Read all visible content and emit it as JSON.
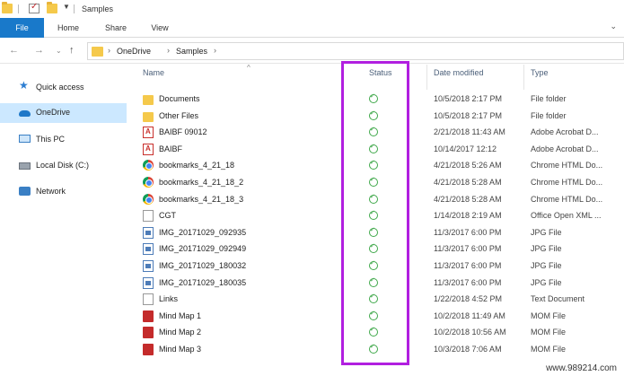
{
  "window": {
    "title": "Samples"
  },
  "ribbon": {
    "tabs": [
      "File",
      "Home",
      "Share",
      "View"
    ],
    "help_icon": "chevron-down-icon"
  },
  "address": {
    "crumbs": [
      "OneDrive",
      "Samples"
    ]
  },
  "sidebar": {
    "items": [
      {
        "label": "Quick access",
        "icon": "star-icon",
        "selected": false
      },
      {
        "label": "OneDrive",
        "icon": "cloud-icon",
        "selected": true
      },
      {
        "label": "This PC",
        "icon": "computer-icon",
        "selected": false
      },
      {
        "label": "Local Disk (C:)",
        "icon": "disk-icon",
        "selected": false
      },
      {
        "label": "Network",
        "icon": "network-icon",
        "selected": false
      }
    ]
  },
  "columns": {
    "name": "Name",
    "status": "Status",
    "date": "Date modified",
    "type": "Type"
  },
  "files": [
    {
      "name": "Documents",
      "date": "10/5/2018 2:17 PM",
      "type": "File folder",
      "icon": "folder"
    },
    {
      "name": "Other Files",
      "date": "10/5/2018 2:17 PM",
      "type": "File folder",
      "icon": "folder"
    },
    {
      "name": "BAIBF 09012",
      "date": "2/21/2018 11:43 AM",
      "type": "Adobe Acrobat D...",
      "icon": "pdf"
    },
    {
      "name": "BAIBF",
      "date": "10/14/2017 12:12",
      "type": "Adobe Acrobat D...",
      "icon": "pdf"
    },
    {
      "name": "bookmarks_4_21_18",
      "date": "4/21/2018 5:26 AM",
      "type": "Chrome HTML Do...",
      "icon": "chrome"
    },
    {
      "name": "bookmarks_4_21_18_2",
      "date": "4/21/2018 5:28 AM",
      "type": "Chrome HTML Do...",
      "icon": "chrome"
    },
    {
      "name": "bookmarks_4_21_18_3",
      "date": "4/21/2018 5:28 AM",
      "type": "Chrome HTML Do...",
      "icon": "chrome"
    },
    {
      "name": "CGT",
      "date": "1/14/2018 2:19 AM",
      "type": "Office Open XML ...",
      "icon": "doc"
    },
    {
      "name": "IMG_20171029_092935",
      "date": "11/3/2017 6:00 PM",
      "type": "JPG File",
      "icon": "jpg"
    },
    {
      "name": "IMG_20171029_092949",
      "date": "11/3/2017 6:00 PM",
      "type": "JPG File",
      "icon": "jpg"
    },
    {
      "name": "IMG_20171029_180032",
      "date": "11/3/2017 6:00 PM",
      "type": "JPG File",
      "icon": "jpg"
    },
    {
      "name": "IMG_20171029_180035",
      "date": "11/3/2017 6:00 PM",
      "type": "JPG File",
      "icon": "jpg"
    },
    {
      "name": "Links",
      "date": "1/22/2018 4:52 PM",
      "type": "Text Document",
      "icon": "txt"
    },
    {
      "name": "Mind Map 1",
      "date": "10/2/2018 11:49 AM",
      "type": "MOM File",
      "icon": "mind"
    },
    {
      "name": "Mind Map 2",
      "date": "10/2/2018 10:56 AM",
      "type": "MOM File",
      "icon": "mind"
    },
    {
      "name": "Mind Map 3",
      "date": "10/3/2018 7:06 AM",
      "type": "MOM File",
      "icon": "mind"
    }
  ],
  "watermark": "www.989214.com",
  "colors": {
    "file_tab": "#1979ca",
    "selected_nav": "#cce8ff",
    "status_ok": "#3fa84a",
    "highlight": "#b11fe0"
  }
}
